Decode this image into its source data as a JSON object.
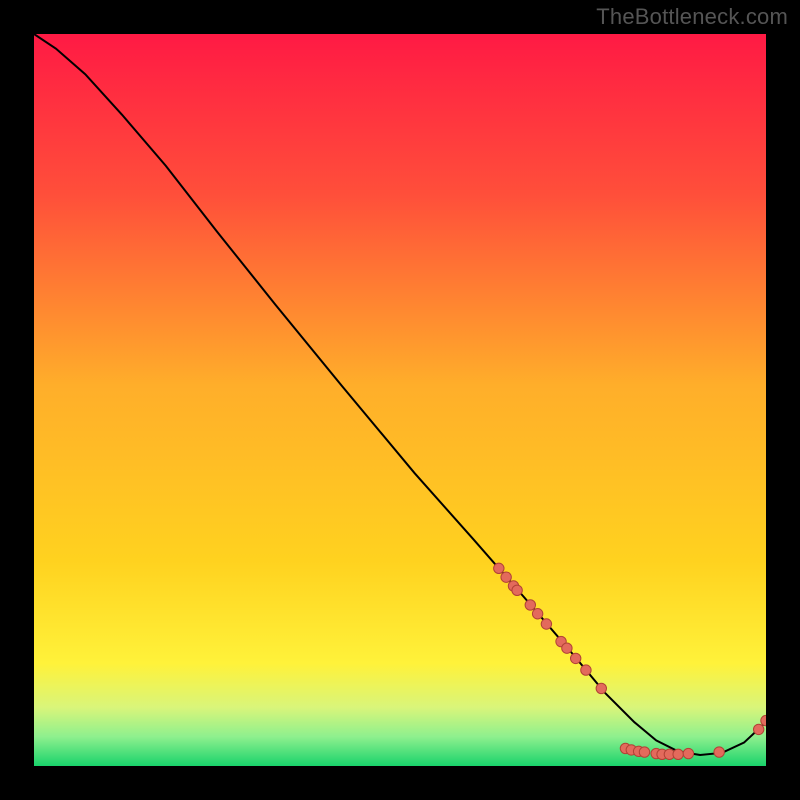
{
  "watermark": "TheBottleneck.com",
  "colors": {
    "background": "#000000",
    "curve": "#000000",
    "marker_fill": "#e36a5c",
    "marker_stroke": "#b24236",
    "gradient_top": "#ff1a44",
    "gradient_mid_upper": "#ff7a2e",
    "gradient_mid": "#ffd21f",
    "gradient_mid_lower": "#fff23a",
    "gradient_lowband": "#8ef08e",
    "gradient_bottom": "#19d36b"
  },
  "chart_data": {
    "type": "line",
    "title": "",
    "xlabel": "",
    "ylabel": "",
    "xlim": [
      0,
      100
    ],
    "ylim": [
      0,
      100
    ],
    "grid": false,
    "legend": false,
    "series": [
      {
        "name": "bottleneck-curve",
        "x": [
          0,
          3,
          7,
          12,
          18,
          25,
          33,
          42,
          52,
          60,
          67,
          73,
          78,
          82,
          85,
          88,
          91,
          94,
          97,
          100
        ],
        "y": [
          100,
          98,
          94.5,
          89,
          82,
          73,
          63,
          52,
          40,
          31,
          23,
          16,
          10,
          6,
          3.5,
          2,
          1.5,
          1.8,
          3.2,
          6
        ]
      }
    ],
    "markers": [
      {
        "x": 63.5,
        "y": 27.0
      },
      {
        "x": 64.5,
        "y": 25.8
      },
      {
        "x": 65.5,
        "y": 24.6
      },
      {
        "x": 66.0,
        "y": 24.0
      },
      {
        "x": 67.8,
        "y": 22.0
      },
      {
        "x": 68.8,
        "y": 20.8
      },
      {
        "x": 70.0,
        "y": 19.4
      },
      {
        "x": 72.0,
        "y": 17.0
      },
      {
        "x": 72.8,
        "y": 16.1
      },
      {
        "x": 74.0,
        "y": 14.7
      },
      {
        "x": 75.4,
        "y": 13.1
      },
      {
        "x": 77.5,
        "y": 10.6
      },
      {
        "x": 80.8,
        "y": 2.4
      },
      {
        "x": 81.6,
        "y": 2.2
      },
      {
        "x": 82.6,
        "y": 2.0
      },
      {
        "x": 83.4,
        "y": 1.9
      },
      {
        "x": 85.0,
        "y": 1.7
      },
      {
        "x": 85.8,
        "y": 1.6
      },
      {
        "x": 86.8,
        "y": 1.6
      },
      {
        "x": 88.0,
        "y": 1.6
      },
      {
        "x": 89.4,
        "y": 1.7
      },
      {
        "x": 93.6,
        "y": 1.9
      },
      {
        "x": 99.0,
        "y": 5.0
      },
      {
        "x": 100.0,
        "y": 6.2
      }
    ],
    "gradient_stops_pct": [
      0,
      22,
      48,
      72,
      86,
      92,
      96,
      100
    ]
  }
}
